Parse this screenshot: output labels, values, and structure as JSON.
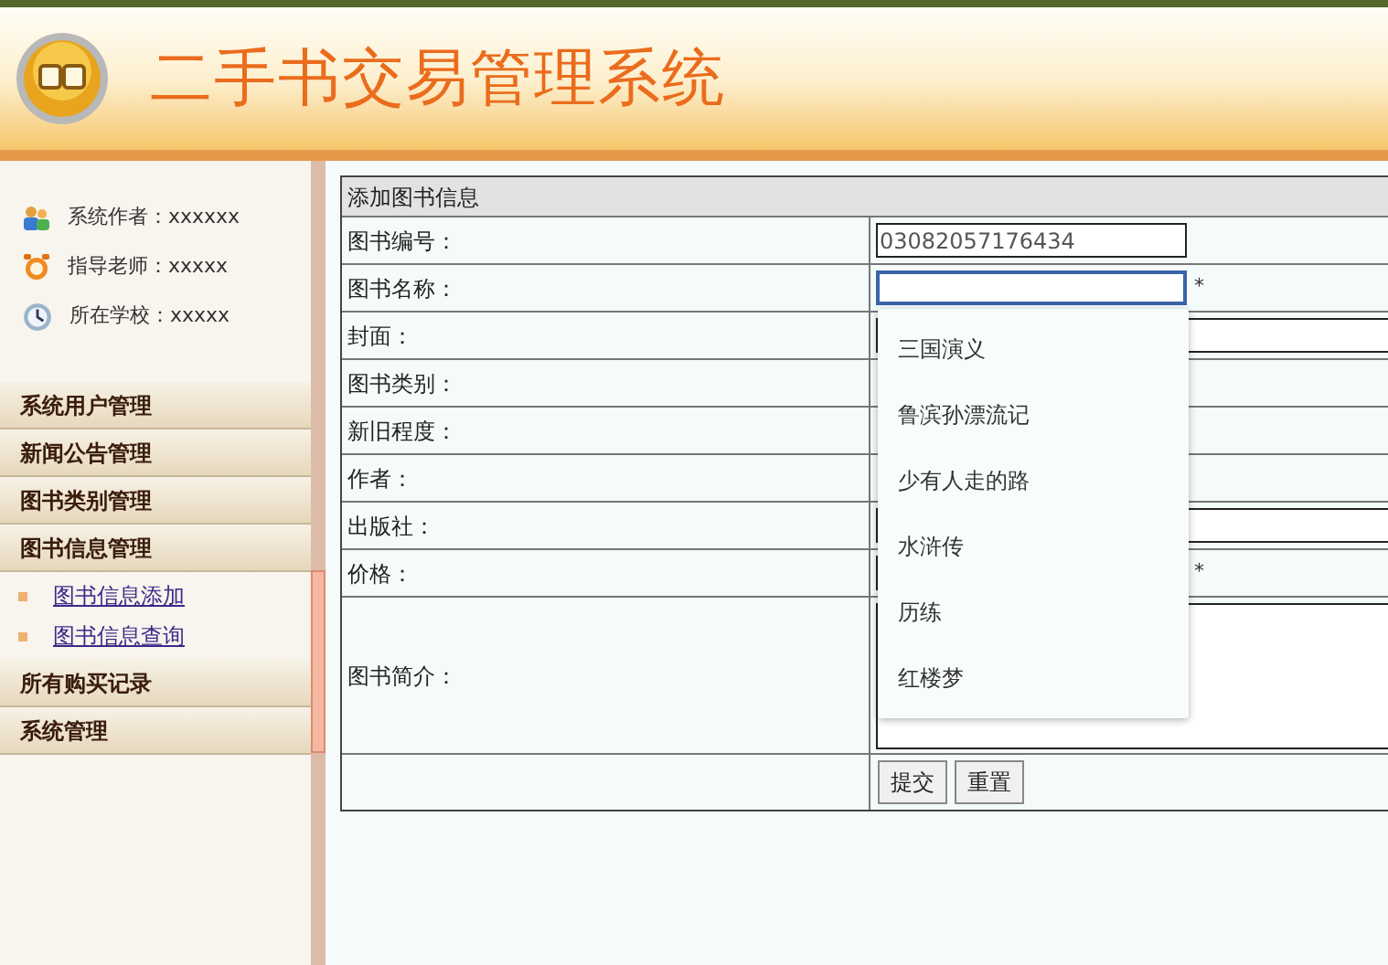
{
  "header": {
    "title": "二手书交易管理系统"
  },
  "info": [
    {
      "kind": "author",
      "text": "系统作者：xxxxxx"
    },
    {
      "kind": "teacher",
      "text": "指导老师：xxxxx"
    },
    {
      "kind": "school",
      "text": "所在学校：xxxxx"
    }
  ],
  "menu": [
    {
      "label": "系统用户管理"
    },
    {
      "label": "新闻公告管理"
    },
    {
      "label": "图书类别管理"
    },
    {
      "label": "图书信息管理",
      "children": [
        {
          "label": "图书信息添加"
        },
        {
          "label": "图书信息查询"
        }
      ]
    },
    {
      "label": "所有购买记录"
    },
    {
      "label": "系统管理"
    }
  ],
  "form": {
    "title": "添加图书信息",
    "rows": [
      {
        "label": "图书编号：",
        "kind": "text",
        "value": "03082057176434"
      },
      {
        "label": "图书名称：",
        "kind": "text",
        "focused": true,
        "required": "*",
        "suggestions": [
          "三国演义",
          "鲁滨孙漂流记",
          "少有人走的路",
          "水浒传",
          "历练",
          "红楼梦"
        ]
      },
      {
        "label": "封面：",
        "kind": "wide"
      },
      {
        "label": "图书类别：",
        "kind": "plain"
      },
      {
        "label": "新旧程度：",
        "kind": "plain"
      },
      {
        "label": "作者：",
        "kind": "plain"
      },
      {
        "label": "出版社：",
        "kind": "wide"
      },
      {
        "label": "价格：",
        "kind": "text",
        "required": "*"
      },
      {
        "label": "图书简介：",
        "kind": "textarea"
      }
    ],
    "buttons": [
      "提交",
      "重置"
    ]
  }
}
